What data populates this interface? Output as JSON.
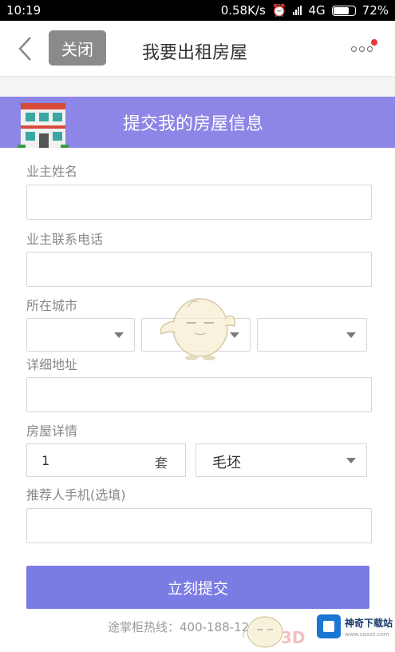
{
  "status_bar": {
    "time": "10:19",
    "net_speed": "0.58K/s",
    "network": "4G",
    "battery": "72%"
  },
  "header": {
    "close_label": "关闭",
    "title": "我要出租房屋"
  },
  "banner": {
    "title": "提交我的房屋信息"
  },
  "form": {
    "owner_name_label": "业主姓名",
    "owner_phone_label": "业主联系电话",
    "city_label": "所在城市",
    "address_label": "详细地址",
    "details_label": "房屋详情",
    "quantity_value": "1",
    "quantity_unit": "套",
    "condition_value": "毛坯",
    "referrer_label": "推荐人手机(选填)",
    "submit_label": "立刻提交"
  },
  "footer": {
    "hotline": "途掌柜热线：400-188-12",
    "watermark_3d": "3D",
    "watermark_name": "神奇下载站",
    "watermark_url": "www.sqxzz.com"
  },
  "colors": {
    "accent": "#7b7ce3",
    "banner": "#8d86e6",
    "close_button": "#8a8a8a",
    "notify_dot": "#e53935"
  }
}
